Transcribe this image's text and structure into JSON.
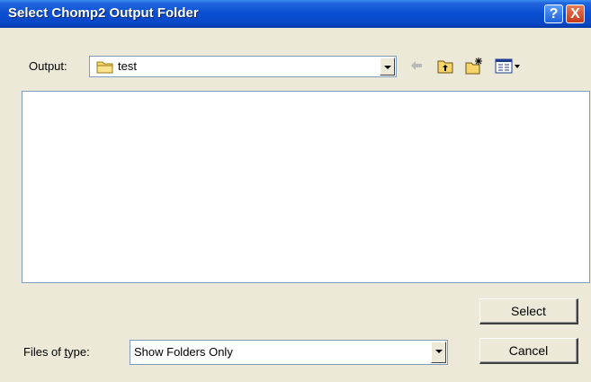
{
  "dialog": {
    "title": "Select Chomp2 Output Folder"
  },
  "titlebar_buttons": {
    "help": "?",
    "close": "X"
  },
  "output": {
    "label": "Output:",
    "value": "test",
    "icon": "folder-icon"
  },
  "toolbar": [
    "back-arrow-icon",
    "up-one-level-icon",
    "create-new-folder-icon",
    "view-menu-icon"
  ],
  "files_of_type": {
    "label": "Files of type:",
    "value": "Show Folders Only"
  },
  "buttons": {
    "select": "Select",
    "cancel": "Cancel"
  }
}
